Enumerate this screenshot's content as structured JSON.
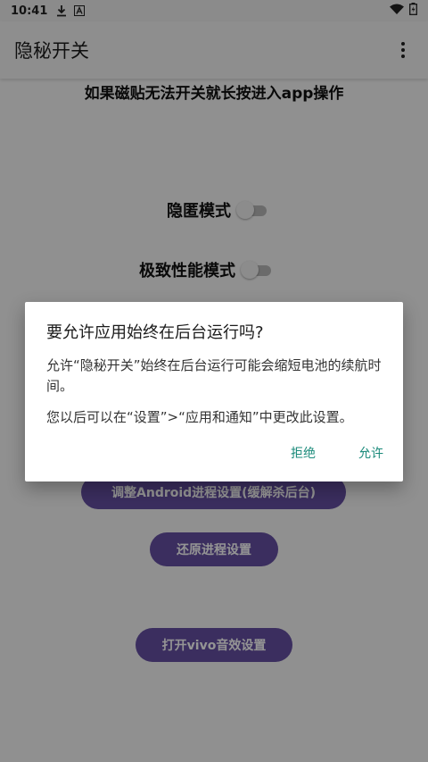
{
  "status_bar": {
    "time": "10:41"
  },
  "app_bar": {
    "title": "隐秘开关"
  },
  "hint": "如果磁贴无法开关就长按进入app操作",
  "toggles": [
    {
      "label": "隐匿模式"
    },
    {
      "label": "极致性能模式"
    }
  ],
  "buttons": [
    {
      "label": "调整Android进程设置(缓解杀后台)"
    },
    {
      "label": "还原进程设置"
    },
    {
      "label": "打开vivo音效设置"
    }
  ],
  "dialog": {
    "title": "要允许应用始终在后台运行吗?",
    "message": "允许“隐秘开关”始终在后台运行可能会缩短电池的续航时间。",
    "message2": "您以后可以在“设置”>“应用和通知”中更改此设置。",
    "deny": "拒绝",
    "allow": "允许"
  },
  "colors": {
    "accent": "#6650a4",
    "dialog_action": "#1a8a7a"
  }
}
